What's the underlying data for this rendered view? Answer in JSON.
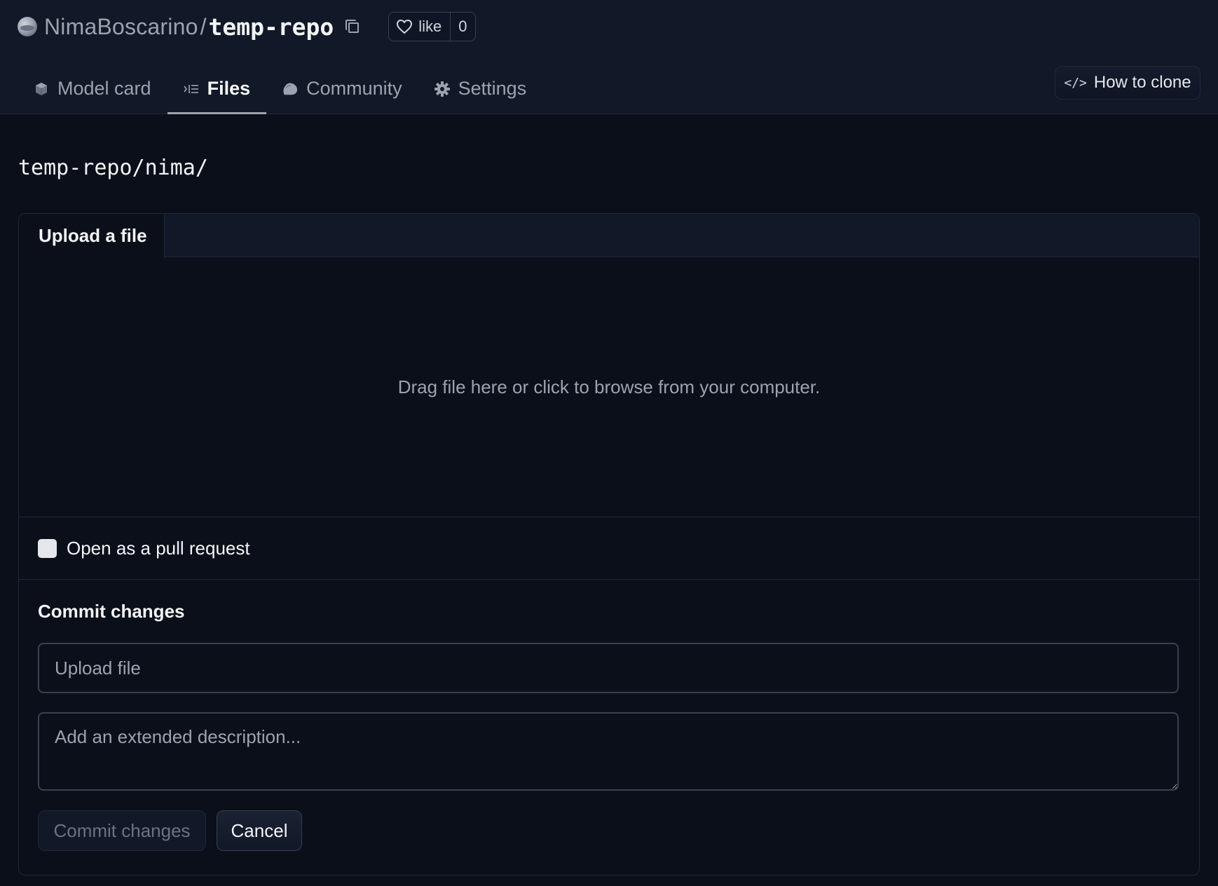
{
  "repo": {
    "owner": "NimaBoscarino",
    "separator": "/",
    "name": "temp-repo",
    "like_label": "like",
    "like_count": "0"
  },
  "tabs": [
    {
      "label": "Model card",
      "icon": "model-card-icon",
      "active": false
    },
    {
      "label": "Files",
      "icon": "files-icon",
      "active": true
    },
    {
      "label": "Community",
      "icon": "community-icon",
      "active": false
    },
    {
      "label": "Settings",
      "icon": "gear-icon",
      "active": false
    }
  ],
  "clone": {
    "label": "How to clone",
    "icon_glyph": "</>"
  },
  "path": "temp-repo/nima/",
  "upload": {
    "tab_label": "Upload a file",
    "dropzone_text": "Drag file here or click to browse from your computer.",
    "pull_request_label": "Open as a pull request",
    "commit_title": "Commit changes",
    "summary_placeholder": "Upload file",
    "description_placeholder": "Add an extended description...",
    "commit_button": "Commit changes",
    "cancel_button": "Cancel"
  },
  "colors": {
    "background": "#0b0f19",
    "header": "#111827",
    "border": "#1f2937",
    "text": "#f3f4f6",
    "muted": "#9ca3af"
  }
}
